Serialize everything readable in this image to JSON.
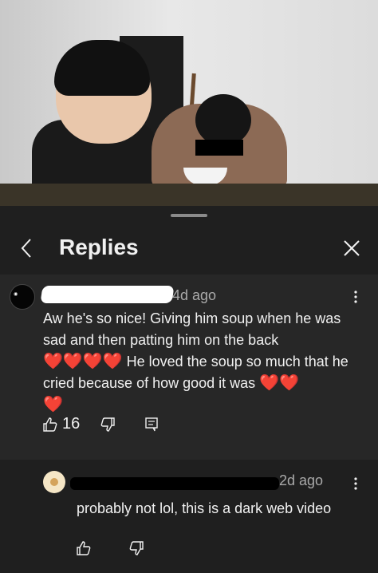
{
  "sheet": {
    "title": "Replies"
  },
  "main_comment": {
    "time": "4d ago",
    "avatar_text": "",
    "body": "Aw he's so nice! Giving him soup when he was sad and then patting him on the back",
    "hearts_row1": "❤️❤️❤️❤️",
    "body_cont": "He loved the soup so much that he cried because of how good it was",
    "hearts_row2": "❤️❤️",
    "hearts_row3": "❤️",
    "like_count": "16"
  },
  "reply_comment": {
    "time": "2d ago",
    "body": "probably not lol, this is a dark web video"
  },
  "icons": [
    "back-chevron-icon",
    "close-icon",
    "more-vert-icon",
    "thumb-up-icon",
    "thumb-down-icon",
    "reply-icon"
  ],
  "colors": {
    "sheet_bg": "#1f1f1f",
    "highlight_bg": "#272727",
    "heart": "#e0312e",
    "meta": "#aaaaaa"
  }
}
